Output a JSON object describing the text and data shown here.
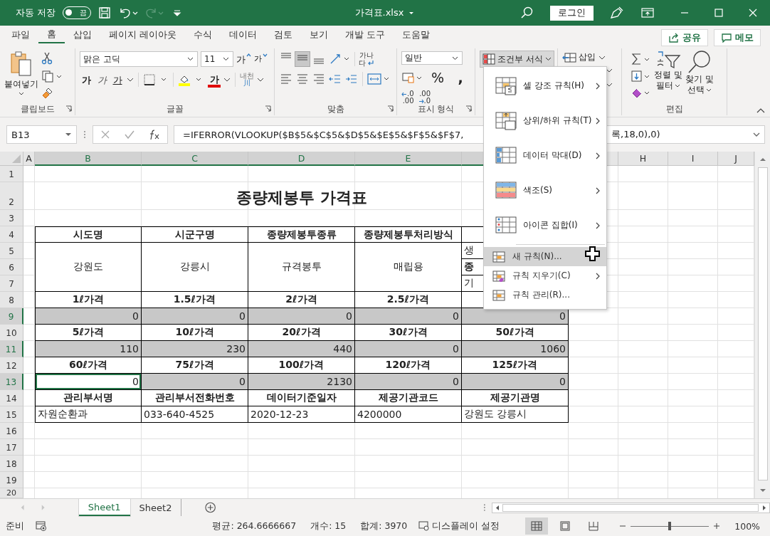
{
  "title_bar": {
    "autosave_label": "자동 저장",
    "autosave": {
      "on": false,
      "text": "끔"
    },
    "filename": "가격표.xlsx",
    "login": "로그인"
  },
  "tabs": [
    {
      "label": "파일",
      "selected": false
    },
    {
      "label": "홈",
      "selected": true
    },
    {
      "label": "삽입",
      "selected": false
    },
    {
      "label": "페이지 레이아웃",
      "selected": false
    },
    {
      "label": "수식",
      "selected": false
    },
    {
      "label": "데이터",
      "selected": false
    },
    {
      "label": "검토",
      "selected": false
    },
    {
      "label": "보기",
      "selected": false
    },
    {
      "label": "개발 도구",
      "selected": false
    },
    {
      "label": "도움말",
      "selected": false
    }
  ],
  "share": "공유",
  "memo": "메모",
  "ribbon": {
    "clipboard": {
      "paste": "붙여넣기",
      "label": "클립보드"
    },
    "font": {
      "name": "맑은 고딕",
      "size": "11",
      "grow": "가",
      "shrink": "가",
      "bold": "가",
      "italic": "가",
      "underline": "가",
      "font_color_button": "가",
      "phonetic": [
        "내천",
        "川"
      ],
      "label": "글꼴"
    },
    "alignment": {
      "wrap_text": [
        "가나",
        "다"
      ],
      "label": "맞춤"
    },
    "number": {
      "format": "일반",
      "percent": "%",
      "comma": ",",
      "increase_decimal": [
        ".0",
        ".00"
      ],
      "decrease_decimal": [
        ".00",
        ".0"
      ],
      "label": "표시 형식"
    },
    "conditional_format": "조건부 서식",
    "insert": "삽입",
    "editing": {
      "sort": [
        "정렬 및",
        "필터"
      ],
      "find": [
        "찾기 및",
        "선택"
      ],
      "label": "편집"
    }
  },
  "formula_bar": {
    "name_box": "B13",
    "formula_left": "=IFERROR(VLOOKUP($B$5&$C$5&$D$5&$E$5&$F$5&$F$7,",
    "formula_right": "록,18,0),0)"
  },
  "sheet": {
    "columns": [
      {
        "label": "A",
        "selected": false
      },
      {
        "label": "B",
        "selected": true
      },
      {
        "label": "C",
        "selected": true
      },
      {
        "label": "D",
        "selected": true
      },
      {
        "label": "E",
        "selected": true
      },
      {
        "selected": true
      },
      {
        "selected": false
      },
      {
        "label": "H",
        "selected": false
      },
      {
        "label": "I",
        "selected": false
      },
      {
        "label": "J",
        "selected": false
      }
    ],
    "rows": [
      {
        "label": "1",
        "selected": false
      },
      {
        "label": "2",
        "selected": false
      },
      {
        "label": "3",
        "selected": false
      },
      {
        "label": "4",
        "selected": false
      },
      {
        "label": "5",
        "selected": false
      },
      {
        "label": "6",
        "selected": false
      },
      {
        "label": "7",
        "selected": false
      },
      {
        "label": "8",
        "selected": false
      },
      {
        "label": "9",
        "selected": true
      },
      {
        "label": "10",
        "selected": false
      },
      {
        "label": "11",
        "selected": true
      },
      {
        "label": "12",
        "selected": false
      },
      {
        "label": "13",
        "selected": true
      },
      {
        "label": "14",
        "selected": false
      },
      {
        "label": "15",
        "selected": false
      },
      {
        "label": "16",
        "selected": false
      },
      {
        "label": "17",
        "selected": false
      },
      {
        "label": "18",
        "selected": false
      },
      {
        "label": "19",
        "selected": false
      },
      {
        "label": "20",
        "selected": false
      }
    ],
    "title": "종량제봉투 가격표",
    "info": {
      "headers": [
        "시도명",
        "시군구명",
        "종량제봉투종류",
        "종량제봉투처리방식"
      ],
      "values": [
        "강원도",
        "강릉시",
        "규격봉투",
        "매립용"
      ],
      "side": [
        "생",
        "종",
        "기"
      ]
    },
    "price_blocks": [
      {
        "labels": [
          "1ℓ가격",
          "1.5ℓ가격",
          "2ℓ가격",
          "2.5ℓ가격"
        ],
        "values": [
          {
            "text": "0",
            "selected": true
          },
          {
            "text": "0",
            "selected": true
          },
          {
            "text": "0",
            "selected": true
          },
          {
            "text": "0",
            "selected": true
          },
          {
            "text": "0",
            "selected": true
          }
        ]
      },
      {
        "labels": [
          "5ℓ가격",
          "10ℓ가격",
          "20ℓ가격",
          "30ℓ가격",
          "50ℓ가격"
        ],
        "values": [
          {
            "text": "110",
            "selected": true
          },
          {
            "text": "230",
            "selected": true
          },
          {
            "text": "440",
            "selected": true
          },
          {
            "text": "0",
            "selected": true
          },
          {
            "text": "1060",
            "selected": true
          }
        ]
      },
      {
        "labels": [
          "60ℓ가격",
          "75ℓ가격",
          "100ℓ가격",
          "120ℓ가격",
          "125ℓ가격"
        ],
        "values": [
          {
            "text": "0",
            "active": true
          },
          {
            "text": "0",
            "selected": true
          },
          {
            "text": "2130",
            "selected": true
          },
          {
            "text": "0",
            "selected": true
          },
          {
            "text": "0",
            "selected": true
          }
        ]
      }
    ],
    "contacts": {
      "headers": [
        "관리부서명",
        "관리부서전화번호",
        "데이터기준일자",
        "제공기관코드",
        "제공기관명"
      ],
      "values": [
        "자원순환과",
        "033-640-4525",
        "2020-12-23",
        "4200000",
        "강원도 강릉시"
      ]
    }
  },
  "cf_menu": {
    "items": [
      {
        "kind": "large",
        "label": "셀 강조 규칙(H)",
        "submenu": true,
        "selected": false
      },
      {
        "kind": "large",
        "label": "상위/하위 규칙(T)",
        "submenu": true,
        "selected": false
      },
      {
        "kind": "large",
        "label": "데이터 막대(D)",
        "submenu": true,
        "selected": false
      },
      {
        "kind": "large",
        "label": "색조(S)",
        "submenu": true,
        "selected": false
      },
      {
        "kind": "large",
        "label": "아이콘 집합(I)",
        "submenu": true,
        "selected": false
      },
      {
        "kind": "small",
        "label": "새 규칙(N)...",
        "submenu": false,
        "selected": true
      },
      {
        "kind": "small",
        "label": "규칙 지우기(C)",
        "submenu": true,
        "selected": false
      },
      {
        "kind": "small",
        "label": "규칙 관리(R)...",
        "submenu": false,
        "selected": false
      }
    ]
  },
  "sheet_tabs": [
    {
      "label": "Sheet1",
      "selected": true
    },
    {
      "label": "Sheet2",
      "selected": false
    }
  ],
  "status_bar": {
    "mode": "준비",
    "average": "평균: 264.6666667",
    "count": "개수: 15",
    "sum": "합계: 3970",
    "display_settings": "디스플레이 설정",
    "views": [
      {
        "selected": true
      },
      {
        "selected": false
      },
      {
        "selected": false
      }
    ],
    "zoom_slider": {
      "level": 0.5
    },
    "zoom": "100%"
  }
}
